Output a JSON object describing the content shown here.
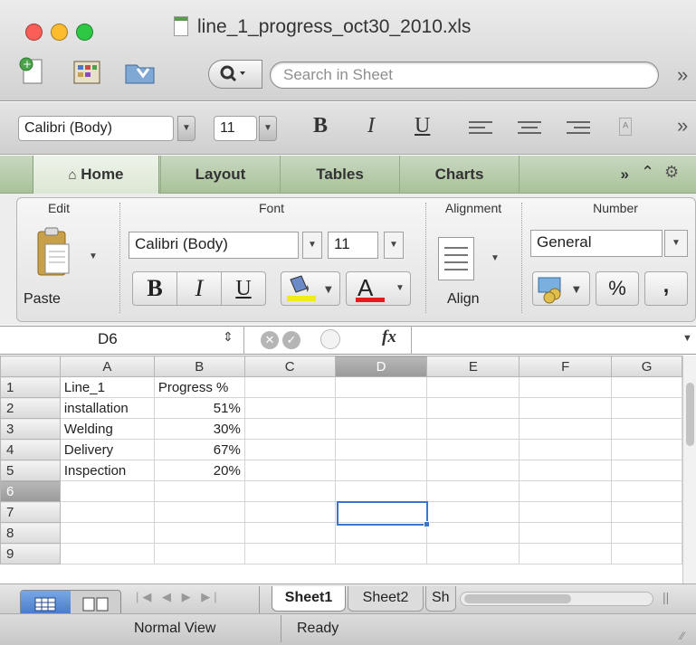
{
  "window": {
    "title": "line_1_progress_oct30_2010.xls",
    "lights": [
      "#fb5d57",
      "#fcbc2e",
      "#2ec845"
    ]
  },
  "toolbar": {
    "search_placeholder": "Search in Sheet",
    "overflow": "»"
  },
  "format_bar": {
    "font_name": "Calibri (Body)",
    "font_size": "11",
    "bold": "B",
    "italic": "I",
    "underline": "U",
    "overflow": "»"
  },
  "ribbon_tabs": {
    "home": "Home",
    "layout": "Layout",
    "tables": "Tables",
    "charts": "Charts",
    "overflow": "»"
  },
  "ribbon": {
    "edit": {
      "title": "Edit",
      "paste_label": "Paste"
    },
    "font": {
      "title": "Font",
      "font_name": "Calibri (Body)",
      "font_size": "11",
      "bold": "B",
      "italic": "I",
      "underline": "U",
      "font_color_letter": "A"
    },
    "alignment": {
      "title": "Alignment",
      "align_label": "Align"
    },
    "number": {
      "title": "Number",
      "format": "General",
      "percent": "%",
      "comma": ","
    }
  },
  "formula_bar": {
    "cell_ref": "D6",
    "fx": "fx"
  },
  "sheet": {
    "columns": [
      "A",
      "B",
      "C",
      "D",
      "E",
      "F",
      "G"
    ],
    "rows": [
      [
        "Line_1",
        "Progress %",
        "",
        "",
        "",
        "",
        ""
      ],
      [
        "installation",
        "51%",
        "",
        "",
        "",
        "",
        ""
      ],
      [
        "Welding",
        "30%",
        "",
        "",
        "",
        "",
        ""
      ],
      [
        "Delivery",
        "67%",
        "",
        "",
        "",
        "",
        ""
      ],
      [
        "Inspection",
        "20%",
        "",
        "",
        "",
        "",
        ""
      ],
      [
        "",
        "",
        "",
        "",
        "",
        "",
        ""
      ],
      [
        "",
        "",
        "",
        "",
        "",
        "",
        ""
      ],
      [
        "",
        "",
        "",
        "",
        "",
        "",
        ""
      ]
    ],
    "row_numbers": [
      "1",
      "2",
      "3",
      "4",
      "5",
      "6",
      "7",
      "8",
      "9"
    ],
    "selected_row": "6",
    "selected_column": "D"
  },
  "sheet_tabs": [
    "Sheet1",
    "Sheet2",
    "Sh"
  ],
  "status": {
    "view": "Normal View",
    "state": "Ready"
  }
}
